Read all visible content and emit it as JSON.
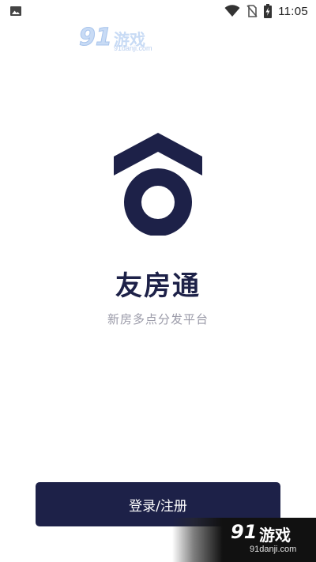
{
  "status_bar": {
    "time": "11:05",
    "icons": [
      "image-notification-icon",
      "wifi-icon",
      "no-sim-icon",
      "battery-charging-icon"
    ]
  },
  "watermark_top": {
    "number": "91",
    "text": "游戏",
    "url": "91danji.com"
  },
  "app": {
    "logo_icon": "house-logo-icon",
    "title": "友房通",
    "subtitle": "新房多点分发平台"
  },
  "actions": {
    "login_register_label": "登录/注册"
  },
  "watermark_bottom": {
    "number": "91",
    "text": "游戏",
    "url": "91danji.com"
  },
  "colors": {
    "brand_navy": "#1d2148",
    "subtitle_gray": "#9a9aa8",
    "background": "#ffffff"
  }
}
